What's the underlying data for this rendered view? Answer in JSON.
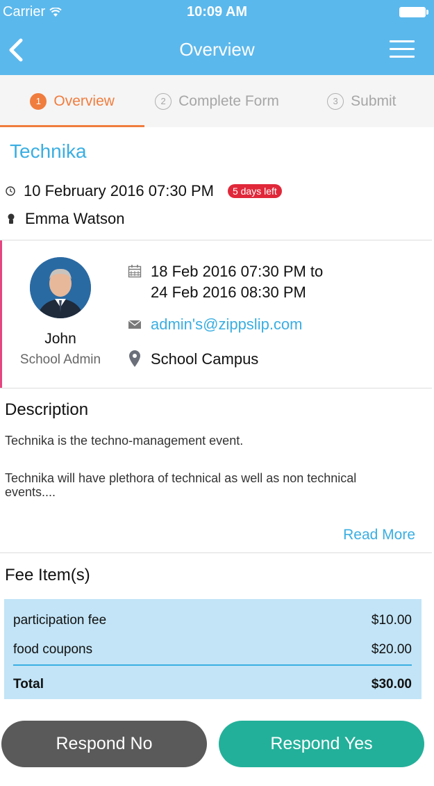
{
  "status_bar": {
    "carrier": "Carrier",
    "time": "10:09 AM"
  },
  "nav": {
    "title": "Overview",
    "back_icon": "chevron-left-icon",
    "menu_icon": "hamburger-menu-icon"
  },
  "steps": [
    {
      "num": "1",
      "label": "Overview",
      "active": true
    },
    {
      "num": "2",
      "label": "Complete Form",
      "active": false
    },
    {
      "num": "3",
      "label": "Submit",
      "active": false
    }
  ],
  "event": {
    "title": "Technika",
    "datetime": "10 February 2016 07:30 PM",
    "badge": "5 days left",
    "organizer": "Emma Watson"
  },
  "contact": {
    "name": "John",
    "role": "School Admin",
    "date_line1": "18 Feb 2016 07:30 PM to",
    "date_line2": "24 Feb 2016 08:30 PM",
    "email": "admin's@zippslip.com",
    "location": "School Campus"
  },
  "description": {
    "heading": "Description",
    "para1": "Technika is the techno-management event.",
    "para2": "Technika will have plethora of technical as well as non technical events....",
    "read_more": "Read More"
  },
  "fees": {
    "heading": "Fee Item(s)",
    "items": [
      {
        "label": "participation fee",
        "amount": "$10.00"
      },
      {
        "label": "food coupons",
        "amount": "$20.00"
      }
    ],
    "total_label": "Total",
    "total_amount": "$30.00"
  },
  "actions": {
    "no_label": "Respond No",
    "yes_label": "Respond Yes"
  },
  "colors": {
    "primary": "#5bb8ec",
    "accent": "#f07d3e",
    "link": "#3aaee2",
    "badge": "#e0283a",
    "yes": "#23b09a",
    "no": "#5a5a5a",
    "contact_bar": "#e5457e",
    "fee_bg": "#c2e4f6"
  }
}
